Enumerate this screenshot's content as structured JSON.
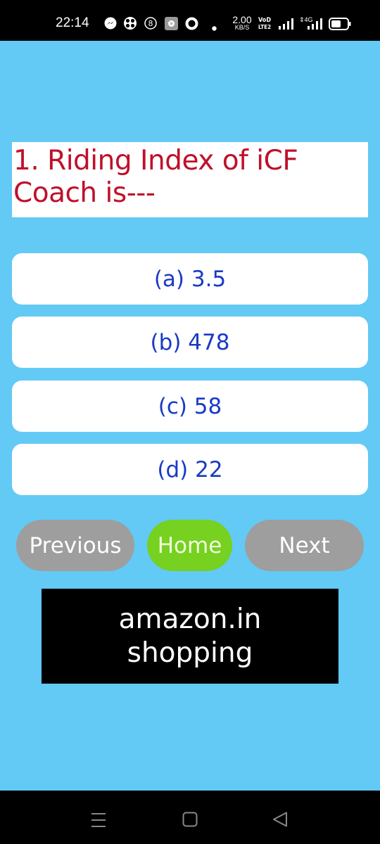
{
  "status_bar": {
    "time": "22:14",
    "net_speed_value": "2.00",
    "net_speed_unit": "KB/S",
    "volte_top": "VoD",
    "volte_bottom": "LTE2",
    "network_type": "4G",
    "notification_icons": [
      "messenger-icon",
      "app-grid-icon",
      "number-8-icon",
      "settings-square-icon",
      "ring-icon",
      "dot-icon"
    ]
  },
  "question": {
    "text": "1. Riding Index of iCF Coach is---",
    "color": "#c0102a"
  },
  "options": [
    {
      "label": "(a) 3.5"
    },
    {
      "label": "(b) 478"
    },
    {
      "label": "(c) 58"
    },
    {
      "label": "(d) 22"
    }
  ],
  "option_text_color": "#1a3ac4",
  "navigation": {
    "previous_label": "Previous",
    "home_label": "Home",
    "next_label": "Next",
    "home_color": "#76d120",
    "nav_color": "#9e9e9e"
  },
  "ad": {
    "line1": "amazon.in",
    "line2": "shopping"
  },
  "system_nav": {
    "buttons": [
      "menu-icon",
      "home-square-icon",
      "back-triangle-icon"
    ]
  },
  "background_color": "#63c9f5"
}
